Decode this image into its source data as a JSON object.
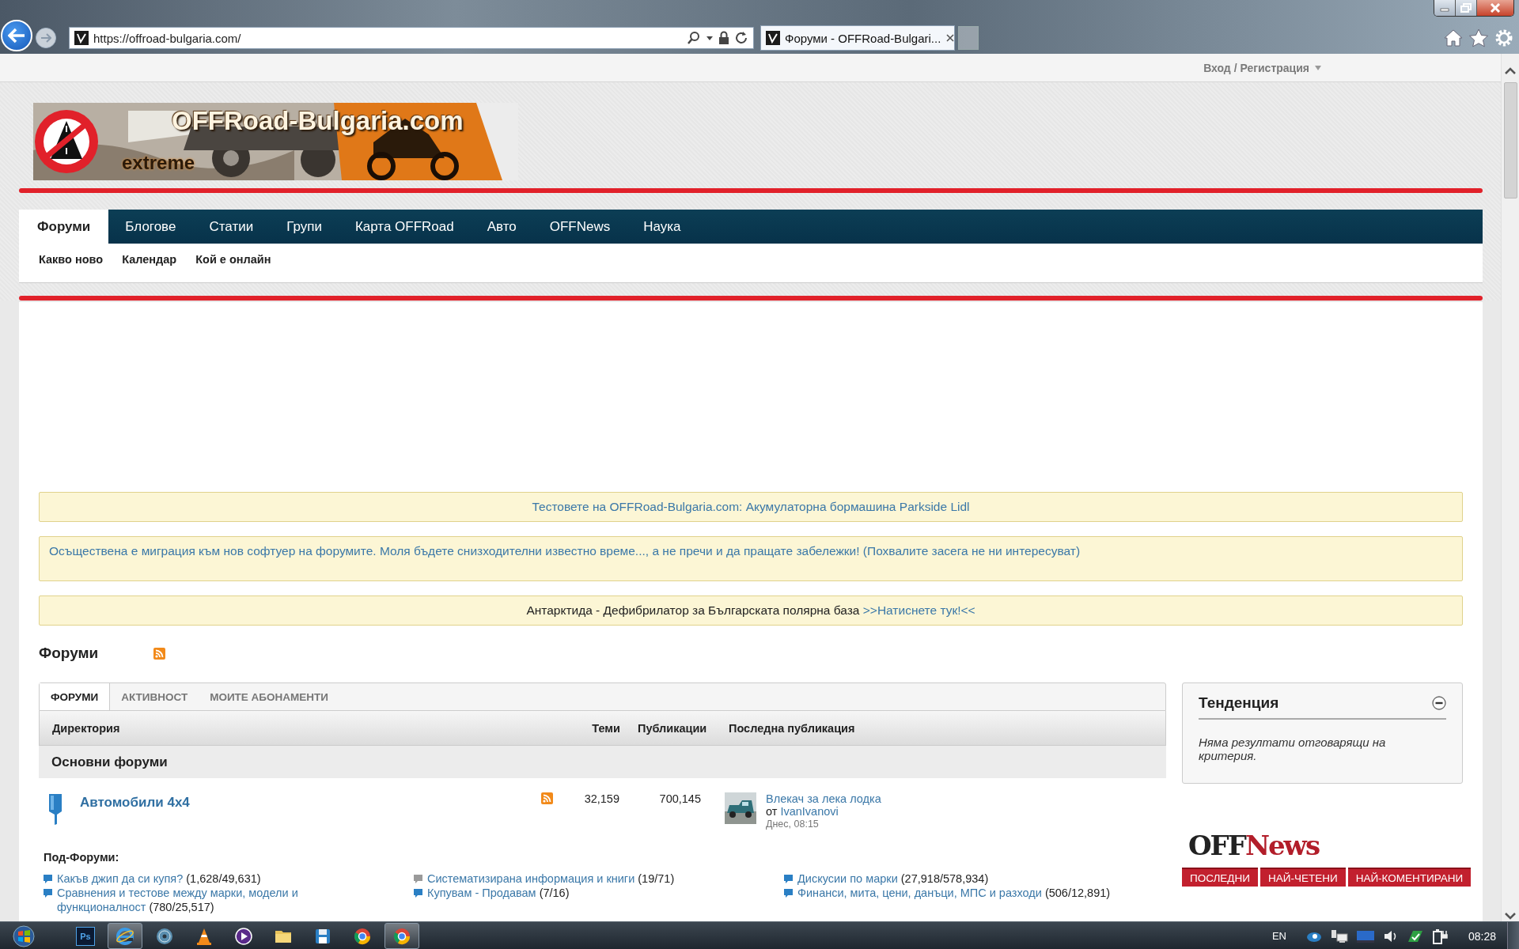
{
  "browser": {
    "address": "https://offroad-bulgaria.com/",
    "tab_title": "Форуми - OFFRoad-Bulgari..."
  },
  "account_link": "Вход / Регистрация",
  "banner": {
    "title": "OFFRoad-Bulgaria.com",
    "tagline": "extreme"
  },
  "nav": {
    "tabs": [
      {
        "label": "Форуми",
        "selected": true
      },
      {
        "label": "Блогове",
        "selected": false
      },
      {
        "label": "Статии",
        "selected": false
      },
      {
        "label": "Групи",
        "selected": false
      },
      {
        "label": "Карта OFFRoad",
        "selected": false
      },
      {
        "label": "Авто",
        "selected": false
      },
      {
        "label": "OFFNews",
        "selected": false
      },
      {
        "label": "Наука",
        "selected": false
      }
    ],
    "subnav": [
      "Какво ново",
      "Календар",
      "Кой е онлайн"
    ]
  },
  "notices": [
    {
      "kind": "link",
      "text": "Тестовете на OFFRoad-Bulgaria.com: Акумулаторна бормашина Parkside Lidl"
    },
    {
      "kind": "announcement",
      "text": "Осъществена е миграция към нов софтуер на форумите. Моля бъдете снизходителни известно време..., а не пречи и да пращате забележки! (Похвалите засега не ни интересуват)"
    },
    {
      "kind": "callout",
      "text": "Антарктида - Дефибрилатор за Българската полярна база",
      "link": ">>Натиснете тук!<<"
    }
  ],
  "forums": {
    "title": "Форуми",
    "tabs": [
      {
        "label": "ФОРУМИ",
        "selected": true
      },
      {
        "label": "АКТИВНОСТ",
        "selected": false
      },
      {
        "label": "МОИТЕ АБОНАМЕНТИ",
        "selected": false
      }
    ],
    "columns": [
      "Директория",
      "Теми",
      "Публикации",
      "Последна публикация"
    ],
    "category": "Основни форуми",
    "list": [
      {
        "name": "Автомобили 4x4",
        "topics": "32,159",
        "posts": "700,145",
        "last_post": {
          "title": "Влекач за лека лодка",
          "by": "от",
          "author": "IvanIvanovi",
          "time": "Днес, 08:15"
        },
        "subforums_label": "Под-Форуми:",
        "subforums": [
          {
            "name": "Какъв джип да си купя?",
            "counts": "(1,628/49,631)",
            "unread": true
          },
          {
            "name": "Систематизирана информация и книги",
            "counts": "(19/71)",
            "unread": false
          },
          {
            "name": "Дискусии по марки",
            "counts": "(27,918/578,934)",
            "unread": true
          },
          {
            "name": "Сравнения и тестове между марки, модели и функционалност",
            "counts": "(780/25,517)",
            "unread": true
          },
          {
            "name": "Купувам - Продавам",
            "counts": "(7/16)",
            "unread": true
          },
          {
            "name": "Финанси, мита, цени, данъци, МПС и разходи",
            "counts": "(506/12,891)",
            "unread": true
          }
        ]
      }
    ]
  },
  "sidebar": {
    "widget": {
      "title": "Тенденция",
      "message": "Няма резултати отговарящи на критерия."
    },
    "offnews": {
      "logo": [
        "OFF",
        "News"
      ],
      "tabs": [
        "ПОСЛЕДНИ",
        "НАЙ-ЧЕТЕНИ",
        "НАЙ-КОМЕНТИРАНИ"
      ]
    }
  },
  "taskbar": {
    "apps": [
      {
        "kind": "photoshop",
        "label": "Ps",
        "running": false
      },
      {
        "kind": "ie",
        "running": true
      },
      {
        "kind": "disc",
        "running": false
      },
      {
        "kind": "cone",
        "running": false
      },
      {
        "kind": "player",
        "running": false
      },
      {
        "kind": "folder",
        "running": false
      },
      {
        "kind": "save",
        "running": false
      },
      {
        "kind": "chrome",
        "running": false
      },
      {
        "kind": "chrome",
        "running": true
      }
    ],
    "language": "EN",
    "clock": "08:28"
  }
}
